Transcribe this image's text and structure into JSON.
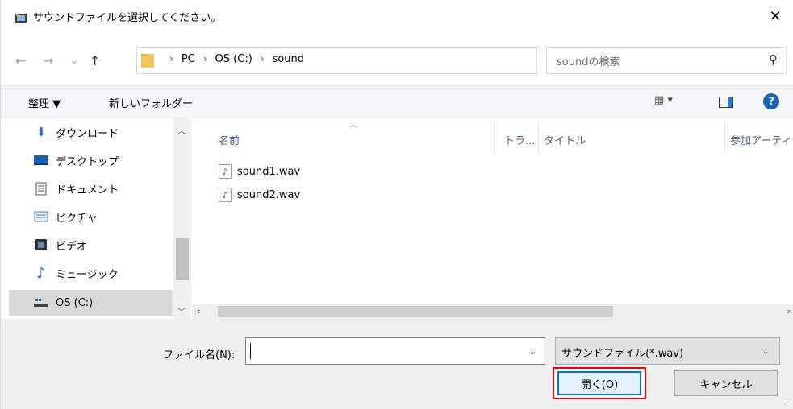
{
  "window": {
    "title": "サウンドファイルを選択してください。",
    "close_glyph": "✕"
  },
  "nav": {
    "back_glyph": "←",
    "forward_glyph": "→",
    "recent_glyph": "⌄",
    "up_glyph": "↑",
    "breadcrumbs": [
      "PC",
      "OS (C:)",
      "sound"
    ],
    "separator": "›",
    "dropdown_glyph": "⌄",
    "refresh_glyph": "↻"
  },
  "search": {
    "placeholder": "soundの検索",
    "icon_glyph": "⚲"
  },
  "toolbar": {
    "organize_label": "整理 ▼",
    "new_folder_label": "新しいフォルダー",
    "view_label": "▦ ▾",
    "help_label": "?"
  },
  "sidebar": {
    "items": [
      {
        "label": "ダウンロード",
        "icon": "download-icon",
        "glyph": "⬇",
        "color": "#1e6fd9"
      },
      {
        "label": "デスクトップ",
        "icon": "desktop-icon",
        "glyph": "",
        "color": "#1f5fb0"
      },
      {
        "label": "ドキュメント",
        "icon": "document-icon",
        "glyph": "",
        "color": "#555555"
      },
      {
        "label": "ピクチャ",
        "icon": "pictures-icon",
        "glyph": "",
        "color": "#5a7da8"
      },
      {
        "label": "ビデオ",
        "icon": "video-icon",
        "glyph": "",
        "color": "#333333"
      },
      {
        "label": "ミュージック",
        "icon": "music-icon",
        "glyph": "♪",
        "color": "#1e73d2"
      },
      {
        "label": "OS (C:)",
        "icon": "drive-icon",
        "glyph": "",
        "color": "#2b8a3e"
      }
    ],
    "selected_index": 6
  },
  "columns": {
    "name": "名前",
    "track": "トラ...",
    "title": "タイトル",
    "artist": "参加アーティ"
  },
  "files": [
    {
      "name": "sound1.wav",
      "icon": "audio-file-icon"
    },
    {
      "name": "sound2.wav",
      "icon": "audio-file-icon"
    }
  ],
  "bottom": {
    "filename_label": "ファイル名(N):",
    "filename_value": "",
    "filter_label": "サウンドファイル(*.wav)",
    "open_label": "開く(O)",
    "cancel_label": "キャンセル"
  },
  "colors": {
    "highlight_box": "#e60012",
    "accent": "#0078d7"
  }
}
